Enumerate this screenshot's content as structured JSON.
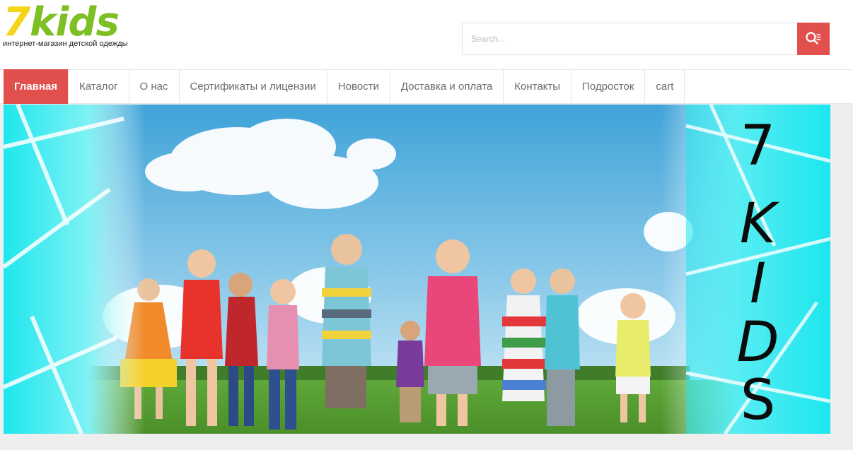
{
  "logo": {
    "seven": "7",
    "kids": "kids",
    "tagline": "интернет-магазин детской одежды"
  },
  "search": {
    "placeholder": "Search...",
    "value": "",
    "button_icon": "search-icon"
  },
  "nav": {
    "items": [
      {
        "label": "Главная",
        "active": true
      },
      {
        "label": "Каталог",
        "active": false
      },
      {
        "label": "О нас",
        "active": false
      },
      {
        "label": "Сертификаты и лицензии",
        "active": false
      },
      {
        "label": "Новости",
        "active": false
      },
      {
        "label": "Доставка и оплата",
        "active": false
      },
      {
        "label": "Контакты",
        "active": false
      },
      {
        "label": "Подросток",
        "active": false
      },
      {
        "label": "cart",
        "active": false
      }
    ]
  },
  "banner": {
    "side_letters": [
      "7",
      "K",
      "I",
      "D",
      "S"
    ]
  },
  "colors": {
    "accent": "#e2504d",
    "logo_yellow": "#f5d417",
    "logo_green": "#7cc023",
    "nav_text": "#6b6b6b",
    "banner_cyan": "#1ee6ee"
  }
}
